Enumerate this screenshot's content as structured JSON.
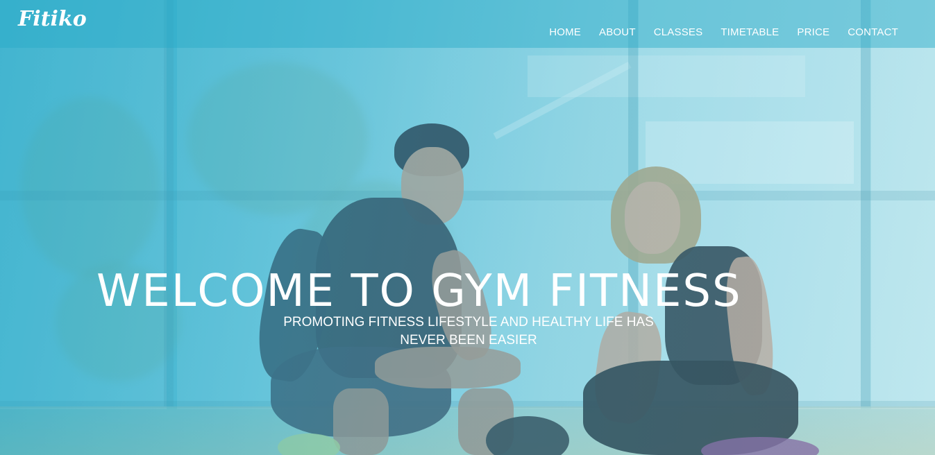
{
  "brand": {
    "logo_text": "Fitiko"
  },
  "nav": {
    "items": [
      {
        "label": "HOME"
      },
      {
        "label": "ABOUT"
      },
      {
        "label": "CLASSES"
      },
      {
        "label": "TIMETABLE"
      },
      {
        "label": "PRICE"
      },
      {
        "label": "CONTACT"
      }
    ]
  },
  "hero": {
    "title": "WELCOME TO GYM FITNESS",
    "subtitle_line1": "PROMOTING FITNESS LIFESTYLE AND HEALTHY LIFE HAS",
    "subtitle_line2": "NEVER BEEN EASIER"
  },
  "colors": {
    "accent": "#2fb0cf",
    "text": "#ffffff"
  }
}
